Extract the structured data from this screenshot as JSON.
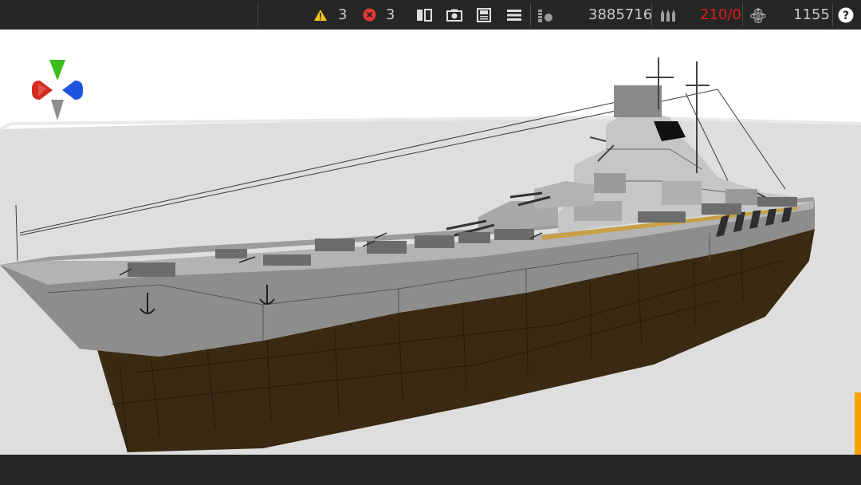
{
  "topbar": {
    "warnings_count": "3",
    "errors_count": "3",
    "cost_value": "3885716",
    "ammo_value": "210/0",
    "weight_value": "1155",
    "icons": {
      "warning": "warning-triangle-icon",
      "error": "error-x-icon",
      "split_view": "split-view-icon",
      "screenshot": "camera-icon",
      "save": "save-icon",
      "menu": "menu-icon",
      "cost": "cost-icon",
      "ammo": "ammo-icon",
      "weight": "weight-blocks-icon",
      "help": "help-icon"
    },
    "colors": {
      "warning": "#f5c518",
      "error": "#e53935",
      "ammo_alert": "#e01a1a"
    }
  },
  "gizmo": {
    "colors": {
      "y": "#3dbd1a",
      "x": "#d42a1f",
      "z": "#1c54e0",
      "neg": "#8e8e8e"
    }
  },
  "bottombar": {
    "icons": {
      "exit": "exit-icon",
      "info": "info-icon",
      "add_block": "add-block-icon",
      "paint": "paint-roller-icon",
      "select": "hand-pointer-icon",
      "move": "move-arrows-icon",
      "resize": "resize-icon",
      "remove_block": "remove-block-icon",
      "prev": "previous-icon",
      "next": "next-icon",
      "build": "build-mode-icon",
      "anchor": "anchor-icon"
    }
  }
}
